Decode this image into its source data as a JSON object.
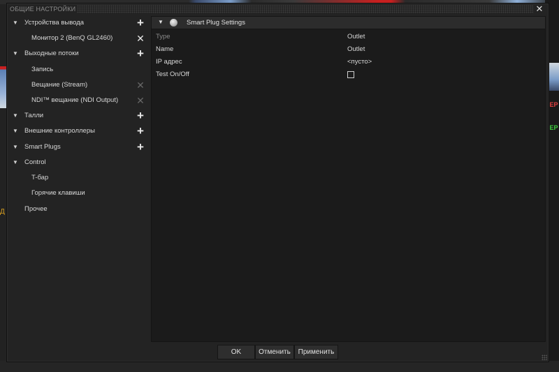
{
  "dialog": {
    "title": "ОБЩИЕ НАСТРОЙКИ",
    "close_icon": "close-icon"
  },
  "tree": {
    "output_devices": {
      "label": "Устройства вывода",
      "child": "Монитор 2 (BenQ GL2460)"
    },
    "output_streams": {
      "label": "Выходные потоки",
      "children": [
        "Запись",
        "Вещание (Stream)",
        "NDI™ вещание (NDI Output)"
      ]
    },
    "tally": {
      "label": "Талли"
    },
    "external_controllers": {
      "label": "Внешние контроллеры"
    },
    "smart_plugs": {
      "label": "Smart Plugs"
    },
    "control": {
      "label": "Control",
      "children": [
        "T-бар",
        "Горячие клавиши"
      ]
    },
    "other": {
      "label": "Прочее"
    }
  },
  "panel": {
    "header_title": "Smart Plug Settings",
    "properties": [
      {
        "name": "Type",
        "value": "Outlet"
      },
      {
        "name": "Name",
        "value": "Outlet"
      },
      {
        "name": "IP адрес",
        "value": "<пусто>"
      },
      {
        "name": "Test On/Off",
        "checked": false
      }
    ]
  },
  "buttons": {
    "ok": "OK",
    "cancel": "Отменить",
    "apply": "Применить"
  },
  "background": {
    "right_red_text": "НЕР",
    "right_green_text": "НЕР",
    "left_text": "Д"
  },
  "colors": {
    "accent_red": "#e04040",
    "accent_green": "#40d040",
    "dialog_bg": "#232323",
    "panel_bg": "#1b1b1b"
  }
}
